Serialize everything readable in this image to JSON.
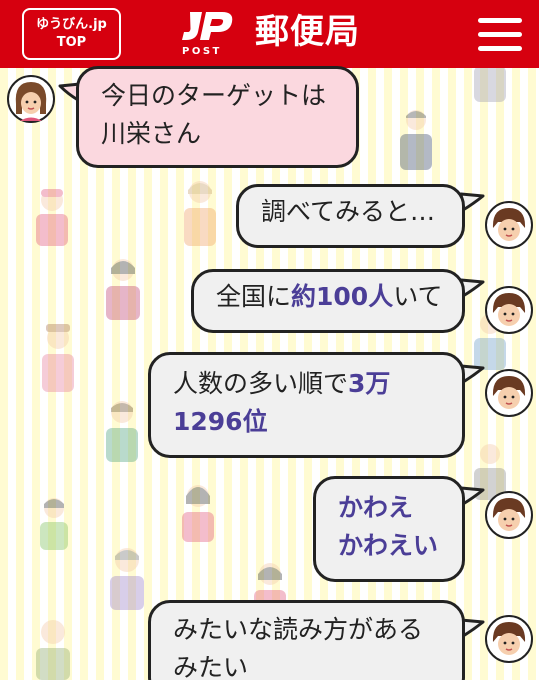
{
  "header": {
    "top_button": {
      "line1": "ゆうびん.jp",
      "line2": "TOP"
    },
    "logo_text": "POST",
    "brand": "郵便局",
    "menu_icon": "hamburger-menu-icon"
  },
  "colors": {
    "header_red": "#d6000f",
    "bubble_gray": "#f0f0f0",
    "bubble_pink": "#fbd8df",
    "highlight": "#4b3e97",
    "stripe_yellow": "#fffbd2"
  },
  "chat": {
    "msg1": {
      "line1": "今日のターゲットは",
      "line2": "川栄さん"
    },
    "msg2": {
      "text": "調べてみると…"
    },
    "msg3": {
      "pre": "全国に",
      "hl": "約100人",
      "post": "いて"
    },
    "msg4": {
      "line1_pre": "人数の多い順で",
      "line1_hl": "3万",
      "line2_hl": "1296位"
    },
    "msg5": {
      "line1": "かわえ",
      "line2": "かわえい"
    },
    "msg6": {
      "line1": "みたいな読み方がある",
      "line2": "みたい"
    }
  }
}
